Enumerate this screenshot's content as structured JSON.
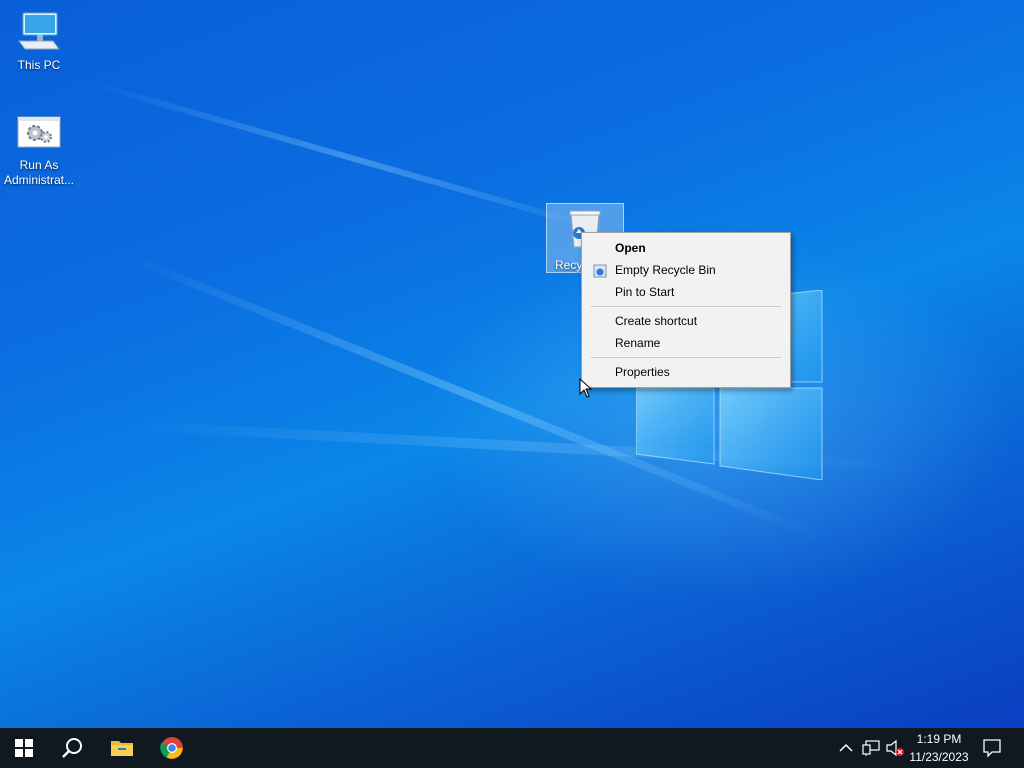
{
  "desktop": {
    "icons": [
      {
        "label": "This PC",
        "icon": "computer-icon"
      },
      {
        "label": "Run As Administrat...",
        "icon": "gears-icon"
      },
      {
        "label": "Recy",
        "icon": "recycle-bin-icon"
      }
    ]
  },
  "context_menu": {
    "items": [
      {
        "label": "Open",
        "bold": true
      },
      {
        "label": "Empty Recycle Bin",
        "icon": "recycle-shield-icon"
      },
      {
        "label": "Pin to Start"
      },
      {
        "label": "Create shortcut"
      },
      {
        "label": "Rename"
      },
      {
        "label": "Properties"
      }
    ]
  },
  "taskbar": {
    "buttons": [
      {
        "name": "start",
        "icon": "windows-icon"
      },
      {
        "name": "search",
        "icon": "search-icon"
      },
      {
        "name": "file-explorer",
        "icon": "folder-icon"
      },
      {
        "name": "chrome",
        "icon": "chrome-icon"
      }
    ],
    "tray": {
      "icons": [
        "chevron-up-icon",
        "network-icon",
        "volume-muted-icon"
      ],
      "time": "1:19 PM",
      "date": "11/23/2023",
      "notification_icon": "notification-icon"
    }
  },
  "colors": {
    "taskbar": "#101820",
    "menu_background": "#f2f2f2",
    "desktop_accent": "#0a6fe0"
  }
}
